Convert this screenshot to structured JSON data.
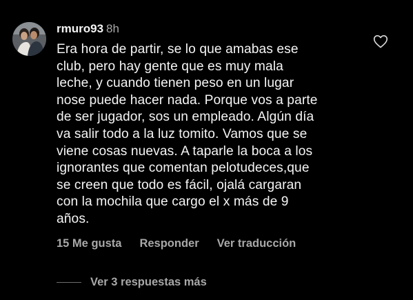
{
  "comment": {
    "username": "rmuro93",
    "time": "8h",
    "text": "Era hora de partir, se lo que amabas ese\nclub, pero hay gente que es muy mala\nleche, y cuando tienen peso en un lugar\nnose puede hacer nada. Porque vos a parte\nde ser jugador, sos un empleado. Algún día\nva salir todo a la luz tomito. Vamos que se\nviene cosas nuevas. A taparle la boca a los\nignorantes que comentan pelotudeces,que\nse creen que todo es fácil, ojalá cargaran\ncon la mochila que cargo el x más de 9\naños.",
    "likes_label": "15 Me gusta",
    "reply_label": "Responder",
    "translate_label": "Ver traducción",
    "view_replies_label": "Ver 3 respuestas más"
  },
  "icons": {
    "like": "heart-outline-icon",
    "avatar": "profile-photo"
  },
  "colors": {
    "background": "#000000",
    "primary_text": "#f5f5f5",
    "secondary_text": "#a8a8a8"
  }
}
